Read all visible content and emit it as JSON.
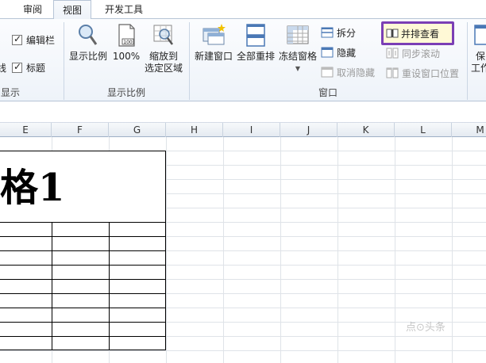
{
  "tabs": [
    {
      "label": "审阅"
    },
    {
      "label": "视图",
      "active": true
    },
    {
      "label": "开发工具"
    }
  ],
  "show_group": {
    "checkbox_formula_bar": "编辑栏",
    "checkbox_headings": "标题",
    "partial_left_text": "线",
    "label": "显示"
  },
  "zoom_group": {
    "zoom_label": "显示比例",
    "hundred_label": "100%",
    "zoom_selection_line1": "缩放到",
    "zoom_selection_line2": "选定区域",
    "label": "显示比例"
  },
  "window_group": {
    "new_window": "新建窗口",
    "arrange_all": "全部重排",
    "freeze_panes": "冻结窗格",
    "split": "拆分",
    "hide": "隐藏",
    "unhide": "取消隐藏",
    "view_side_by_side": "并排查看",
    "sync_scroll": "同步滚动",
    "reset_position": "重设窗口位置",
    "label": "窗口"
  },
  "save_group": {
    "line1": "保",
    "line2": "工作"
  },
  "columns": [
    "E",
    "F",
    "G",
    "H",
    "I",
    "J",
    "K",
    "L",
    "M"
  ],
  "sheet": {
    "title_text": "格1"
  },
  "watermark": "点⊙头条",
  "colors": {
    "highlight_border": "#7b3fb5",
    "highlight_fill": "#fff9d6",
    "ribbon_bg": "#eef3f9"
  }
}
